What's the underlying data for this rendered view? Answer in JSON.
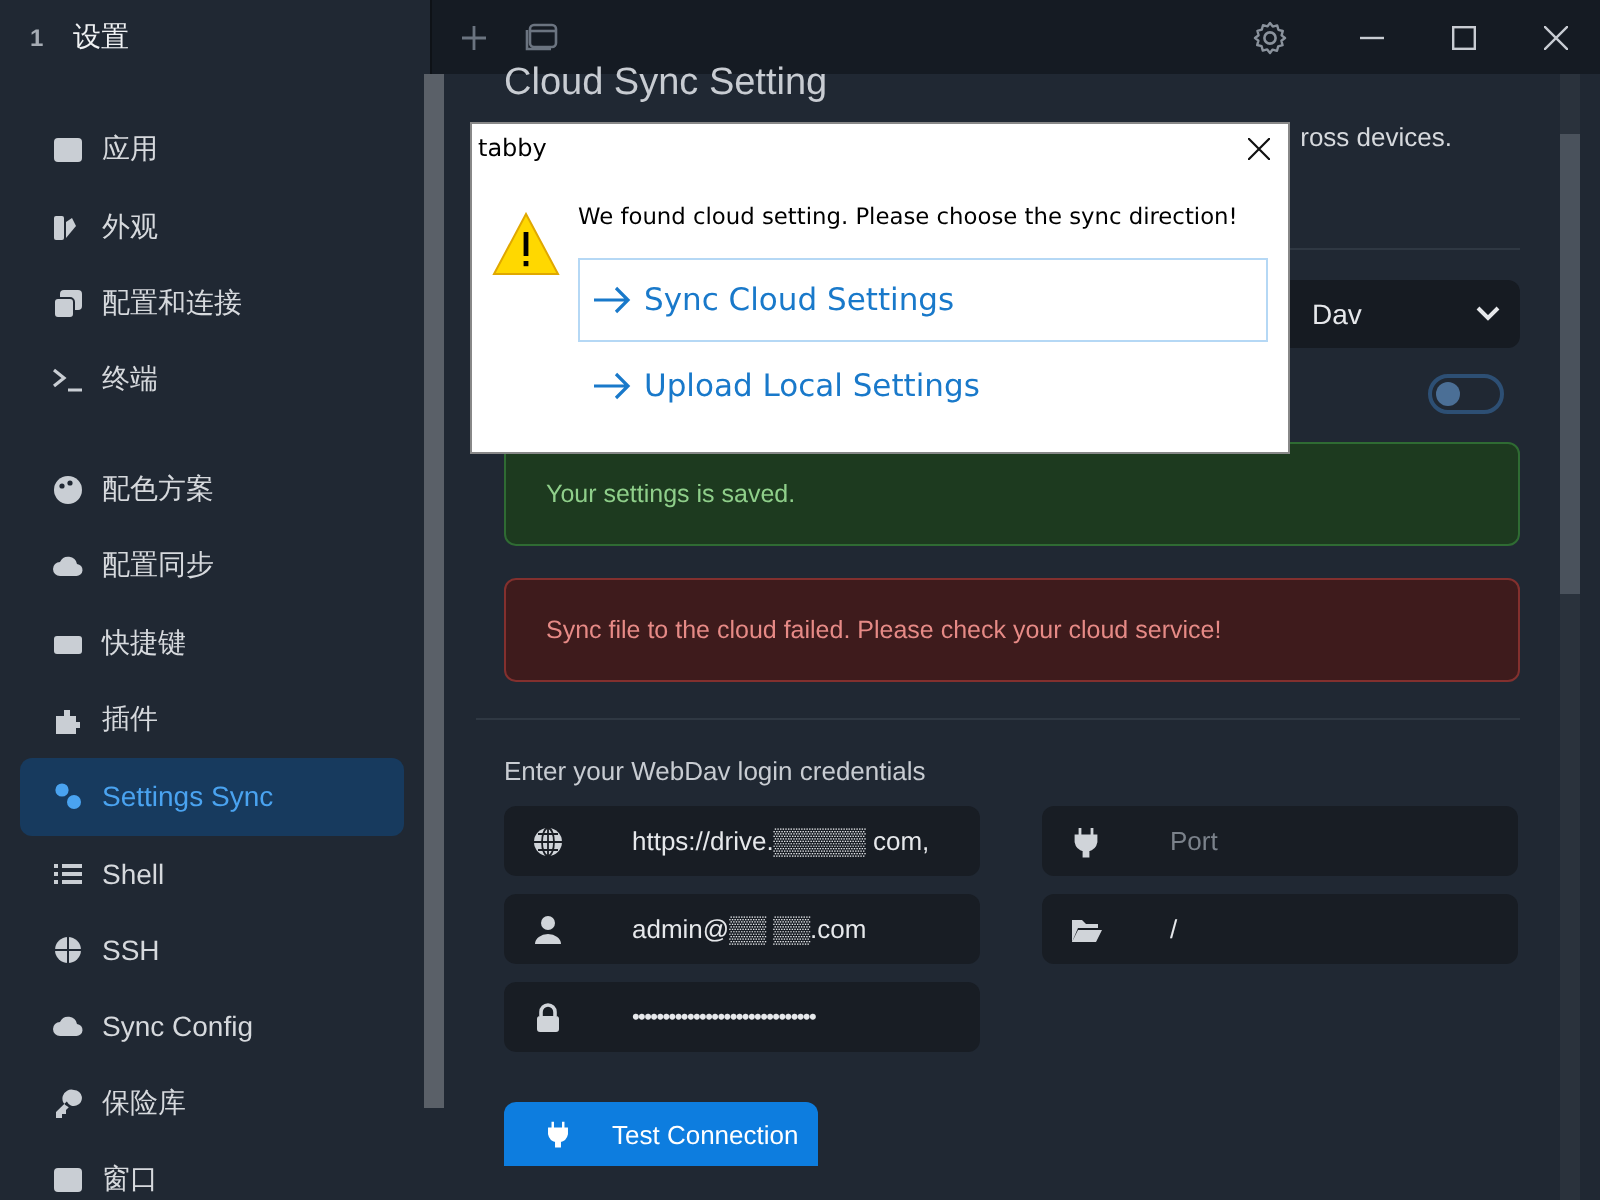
{
  "titlebar": {
    "tab_number": "1",
    "tab_title": "设置"
  },
  "sidebar": {
    "items": [
      {
        "label": "应用",
        "selected": false
      },
      {
        "label": "外观",
        "selected": false
      },
      {
        "label": "配置和连接",
        "selected": false
      },
      {
        "label": "终端",
        "selected": false
      },
      {
        "label": "配色方案",
        "selected": false
      },
      {
        "label": "配置同步",
        "selected": false
      },
      {
        "label": "快捷键",
        "selected": false
      },
      {
        "label": "插件",
        "selected": false
      },
      {
        "label": "Settings Sync",
        "selected": true
      },
      {
        "label": "Shell",
        "selected": false
      },
      {
        "label": "SSH",
        "selected": false
      },
      {
        "label": "Sync Config",
        "selected": false
      },
      {
        "label": "保险库",
        "selected": false
      },
      {
        "label": "窗口",
        "selected": false
      }
    ]
  },
  "content": {
    "heading": "Cloud Sync Setting",
    "description": "ross devices.",
    "provider_select": {
      "value": "Dav"
    },
    "toggle": {
      "on": false
    },
    "alerts": [
      {
        "kind": "success",
        "text": "Your settings is saved."
      },
      {
        "kind": "error",
        "text": "Sync file to the cloud failed. Please check your cloud service!"
      }
    ],
    "credentials_label": "Enter your WebDav login credentials",
    "fields": [
      {
        "value": "https://drive.▒▒▒▒▒ com,"
      },
      {
        "placeholder": "Port"
      },
      {
        "value": "admin@▒▒ ▒▒.com"
      },
      {
        "value": "/"
      },
      {
        "value": "••••••••••••••••••••••••••••••"
      }
    ],
    "test_button": "Test Connection"
  },
  "dialog": {
    "title": "tabby",
    "message": "We found cloud setting. Please choose the sync direction!",
    "options": [
      {
        "label": "Sync Cloud Settings",
        "selected": true
      },
      {
        "label": "Upload Local Settings",
        "selected": false
      }
    ]
  }
}
